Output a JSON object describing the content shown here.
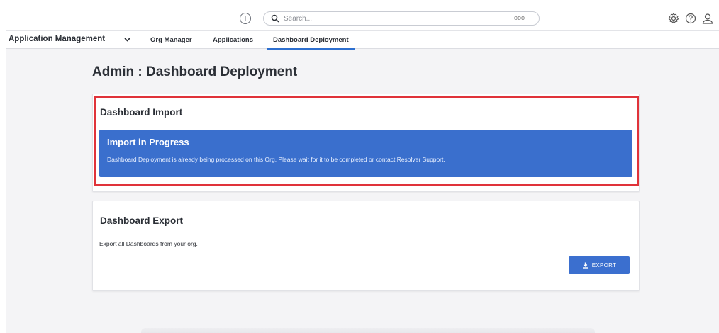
{
  "topbar": {
    "search_placeholder": "Search...",
    "search_dots": "ooo",
    "icons": [
      "add-icon",
      "search-icon",
      "gear-icon",
      "help-icon",
      "user-icon"
    ]
  },
  "nav": {
    "app_name": "Application Management",
    "tabs": [
      {
        "label": "Org Manager",
        "active": false
      },
      {
        "label": "Applications",
        "active": false
      },
      {
        "label": "Dashboard Deployment",
        "active": true
      }
    ]
  },
  "page": {
    "title": "Admin : Dashboard Deployment"
  },
  "import_card": {
    "title": "Dashboard Import",
    "banner_title": "Import in Progress",
    "banner_message": "Dashboard Deployment is already being processed on this Org.  Please wait for it to be completed or contact Resolver Support."
  },
  "export_card": {
    "title": "Dashboard Export",
    "description": "Export all Dashboards from your org.",
    "button_label": "EXPORT"
  },
  "colors": {
    "accent": "#3a6fcd",
    "highlight": "#e0333a",
    "background": "#f4f4f6"
  }
}
